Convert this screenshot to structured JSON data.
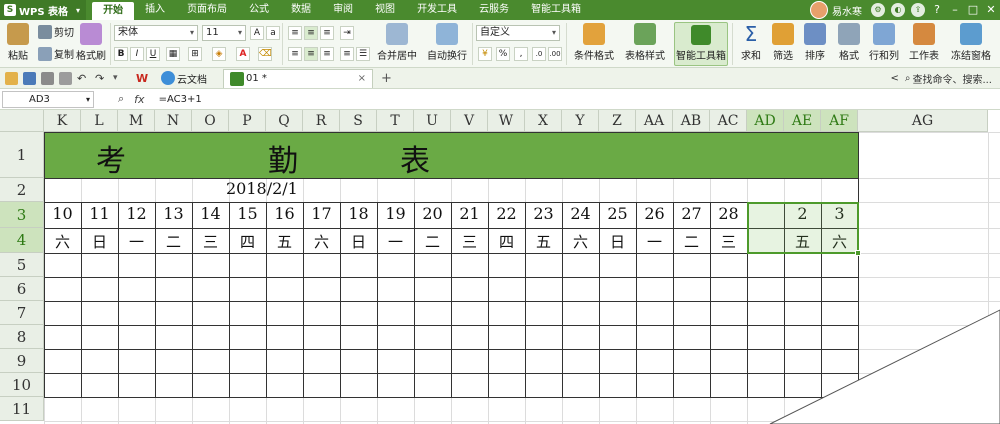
{
  "menubar": {
    "app_name": "WPS 表格",
    "tabs": [
      "开始",
      "插入",
      "页面布局",
      "公式",
      "数据",
      "审阅",
      "视图",
      "开发工具",
      "云服务",
      "智能工具箱"
    ],
    "active_tab": "开始",
    "user_name": "易水寒",
    "window_buttons": [
      "?",
      "–",
      "□",
      "✕"
    ]
  },
  "ribbon": {
    "paste": "粘贴",
    "cut": "剪切",
    "copy": "复制",
    "format_painter": "格式刷",
    "font_name": "宋体",
    "font_size": "11",
    "number_format": "自定义",
    "merge_center": "合并居中",
    "wrap_text": "自动换行",
    "conditional_format": "条件格式",
    "table_style": "表格样式",
    "smart_toolbox": "智能工具箱",
    "sum": "求和",
    "filter": "筛选",
    "sort": "排序",
    "format": "格式",
    "row_col": "行和列",
    "worksheet": "工作表",
    "freeze": "冻结窗格",
    "percent": "%",
    "comma": ",",
    "font_color_a": "A",
    "bold": "B",
    "italic": "I",
    "underline": "U"
  },
  "docbar": {
    "cloud_docs": "云文档",
    "doc_name": "01 *",
    "close": "×",
    "add": "+",
    "search_placeholder": "查找命令、搜索..."
  },
  "formula": {
    "cell_ref": "AD3",
    "fx": "fx",
    "content": "=AC3+1"
  },
  "sheet": {
    "columns": [
      "K",
      "L",
      "M",
      "N",
      "O",
      "P",
      "Q",
      "R",
      "S",
      "T",
      "U",
      "V",
      "W",
      "X",
      "Y",
      "Z",
      "AA",
      "AB",
      "AC",
      "AD",
      "AE",
      "AF",
      "AG"
    ],
    "selected_columns": [
      "AD",
      "AE",
      "AF"
    ],
    "rows": [
      "1",
      "2",
      "3",
      "4",
      "5",
      "6",
      "7",
      "8",
      "9",
      "10",
      "11"
    ],
    "selected_rows": [
      "3",
      "4"
    ],
    "title_chars": [
      "考",
      "勤",
      "表"
    ],
    "date": "2018/2/1",
    "days": [
      "10",
      "11",
      "12",
      "13",
      "14",
      "15",
      "16",
      "17",
      "18",
      "19",
      "20",
      "21",
      "22",
      "23",
      "24",
      "25",
      "26",
      "27",
      "28",
      "",
      "2",
      "3"
    ],
    "weekdays": [
      "六",
      "日",
      "一",
      "二",
      "三",
      "四",
      "五",
      "六",
      "日",
      "一",
      "二",
      "三",
      "四",
      "五",
      "六",
      "日",
      "一",
      "二",
      "三",
      "",
      "五",
      "六"
    ],
    "title_band_color": "#6aaa45",
    "selection_color": "#4d9a2b"
  }
}
